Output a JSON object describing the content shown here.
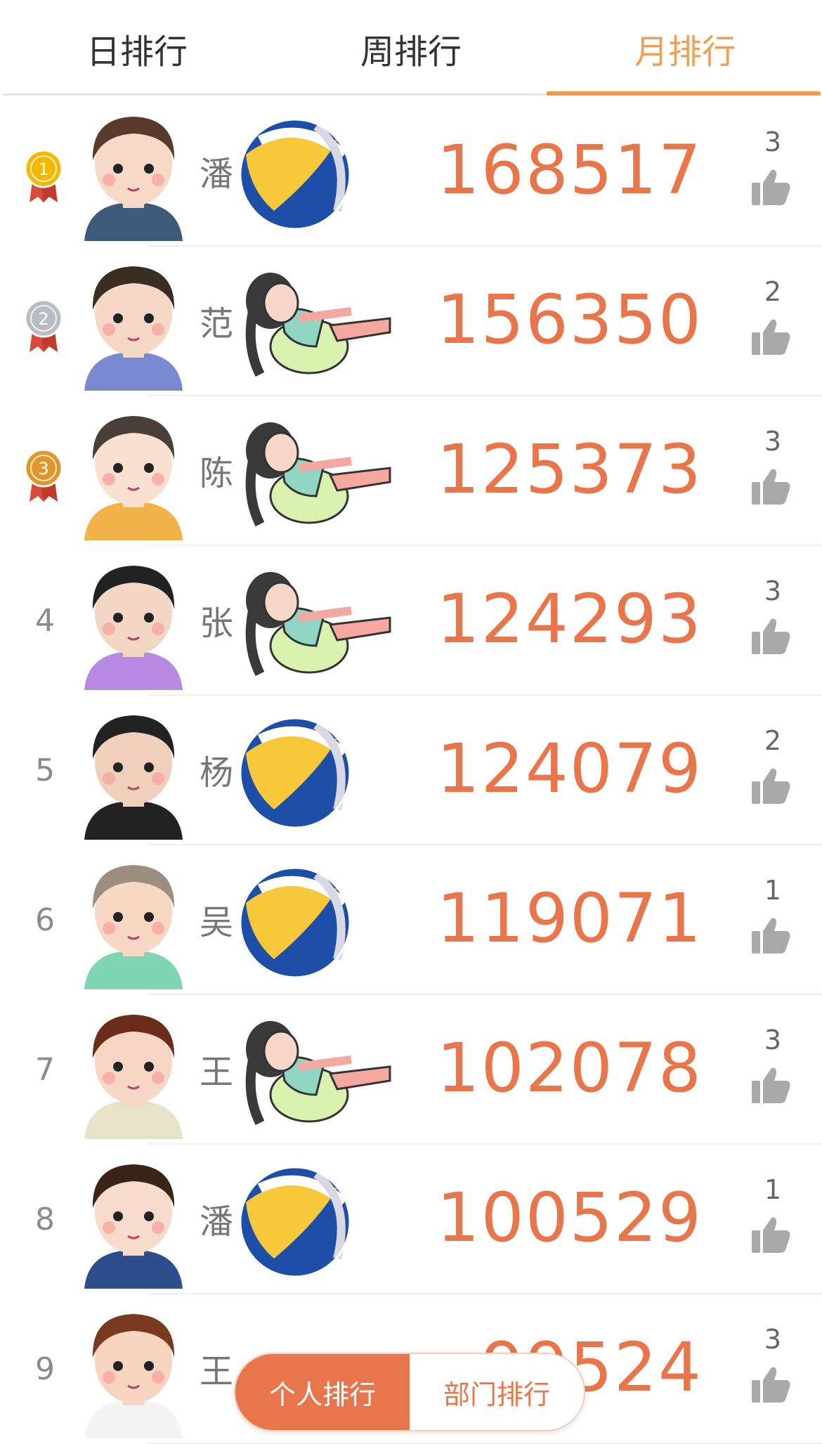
{
  "tabs": [
    {
      "label": "日排行",
      "active": false
    },
    {
      "label": "周排行",
      "active": false
    },
    {
      "label": "月排行",
      "active": true
    }
  ],
  "colors": {
    "accent": "#e8764a",
    "tab_active": "#f0a056",
    "gold": "#f5b800",
    "silver": "#b9bcc2",
    "bronze": "#e0972a"
  },
  "rows": [
    {
      "rank": "1",
      "medal": "gold",
      "name": "潘",
      "score": "168517",
      "likes": "3",
      "sticker": "volleyball"
    },
    {
      "rank": "2",
      "medal": "silver",
      "name": "范",
      "score": "156350",
      "likes": "2",
      "sticker": "situp-girl"
    },
    {
      "rank": "3",
      "medal": "bronze",
      "name": "陈",
      "score": "125373",
      "likes": "3",
      "sticker": "situp-girl"
    },
    {
      "rank": "4",
      "medal": "",
      "name": "张",
      "score": "124293",
      "likes": "3",
      "sticker": "situp-girl"
    },
    {
      "rank": "5",
      "medal": "",
      "name": "杨",
      "score": "124079",
      "likes": "2",
      "sticker": "volleyball"
    },
    {
      "rank": "6",
      "medal": "",
      "name": "吴",
      "score": "119071",
      "likes": "1",
      "sticker": "volleyball"
    },
    {
      "rank": "7",
      "medal": "",
      "name": "王",
      "score": "102078",
      "likes": "3",
      "sticker": "situp-girl"
    },
    {
      "rank": "8",
      "medal": "",
      "name": "潘",
      "score": "100529",
      "likes": "1",
      "sticker": "volleyball"
    },
    {
      "rank": "9",
      "medal": "",
      "name": "王",
      "score": "99524",
      "likes": "3",
      "sticker": ""
    }
  ],
  "segment": {
    "personal": "个人排行",
    "department": "部门排行"
  }
}
